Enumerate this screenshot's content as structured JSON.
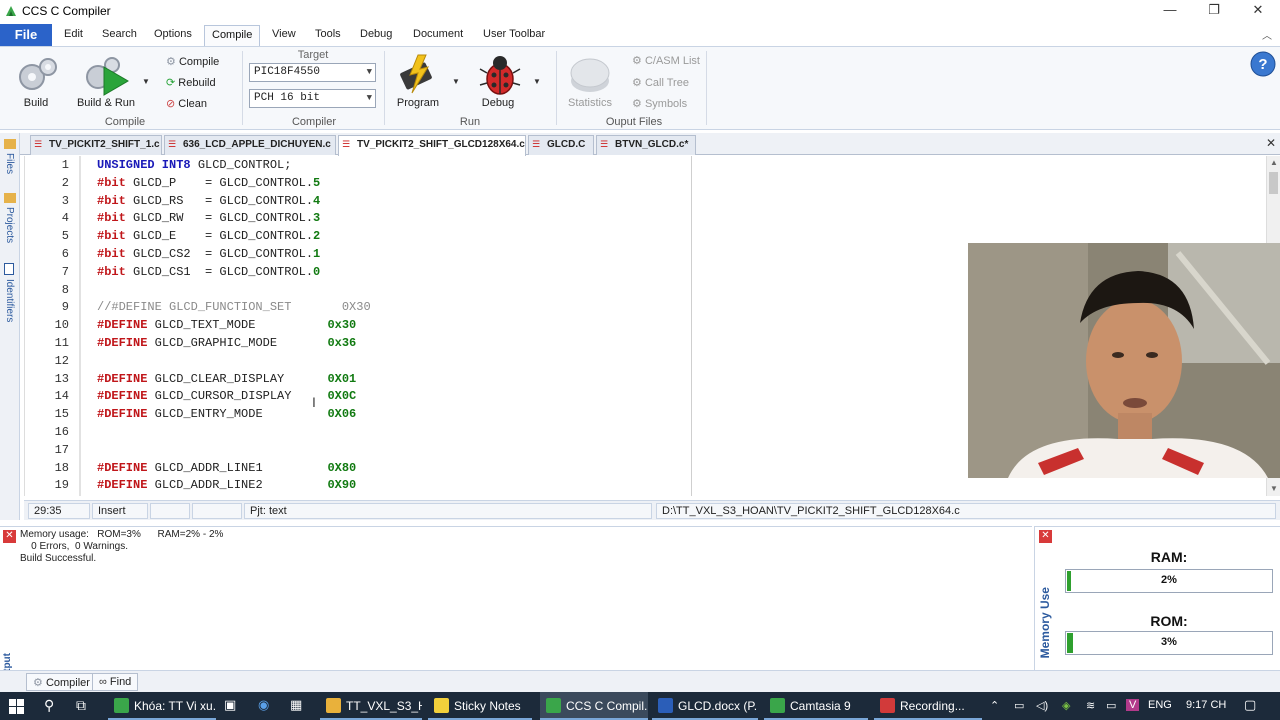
{
  "window": {
    "title": "CCS C Compiler",
    "minimize": "—",
    "maximize": "❐",
    "close": "✕"
  },
  "menu": {
    "file": "File",
    "tabs": [
      "Edit",
      "Search",
      "Options",
      "Compile",
      "View",
      "Tools",
      "Debug",
      "Document",
      "User Toolbar"
    ],
    "active": "Compile"
  },
  "ribbon": {
    "build": "Build",
    "build_run": "Build & Run",
    "compile": "Compile",
    "rebuild": "Rebuild",
    "clean": "Clean",
    "group_compile": "Compile",
    "target_label": "Target",
    "target_device": "PIC18F4550",
    "target_compiler": "PCH 16 bit",
    "group_compiler": "Compiler",
    "program": "Program",
    "debug": "Debug",
    "group_run": "Run",
    "statistics": "Statistics",
    "casm_list": "C/ASM List",
    "call_tree": "Call Tree",
    "symbols": "Symbols",
    "group_output": "Ouput Files"
  },
  "doc_tabs": [
    {
      "label": "TV_PICKIT2_SHIFT_1.c"
    },
    {
      "label": "636_LCD_APPLE_DICHUYEN.c"
    },
    {
      "label": "TV_PICKIT2_SHIFT_GLCD128X64.c"
    },
    {
      "label": "GLCD.C"
    },
    {
      "label": "BTVN_GLCD.c*"
    }
  ],
  "side_tabs": {
    "files": "Files",
    "projects": "Projects",
    "identifiers": "Identifiers"
  },
  "editor": {
    "line_numbers": [
      "1",
      "2",
      "3",
      "4",
      "5",
      "6",
      "7",
      "8",
      "9",
      "10",
      "11",
      "12",
      "13",
      "14",
      "15",
      "16",
      "17",
      "18",
      "19"
    ],
    "lines": [
      {
        "a": "UNSIGNED INT8",
        "b": " GLCD_CONTROL;",
        "c": ""
      },
      {
        "a": "#bit",
        "b": " GLCD_P    = GLCD_CONTROL.",
        "c": "5"
      },
      {
        "a": "#bit",
        "b": " GLCD_RS   = GLCD_CONTROL.",
        "c": "4"
      },
      {
        "a": "#bit",
        "b": " GLCD_RW   = GLCD_CONTROL.",
        "c": "3"
      },
      {
        "a": "#bit",
        "b": " GLCD_E    = GLCD_CONTROL.",
        "c": "2"
      },
      {
        "a": "#bit",
        "b": " GLCD_CS2  = GLCD_CONTROL.",
        "c": "1"
      },
      {
        "a": "#bit",
        "b": " GLCD_CS1  = GLCD_CONTROL.",
        "c": "0"
      },
      {
        "a": "",
        "b": "",
        "c": ""
      },
      {
        "a": "",
        "b": "//#DEFINE GLCD_FUNCTION_SET       0X30",
        "c": ""
      },
      {
        "a": "#DEFINE",
        "b": " GLCD_TEXT_MODE          ",
        "c": "0x30"
      },
      {
        "a": "#DEFINE",
        "b": " GLCD_GRAPHIC_MODE       ",
        "c": "0x36"
      },
      {
        "a": "",
        "b": "",
        "c": ""
      },
      {
        "a": "#DEFINE",
        "b": " GLCD_CLEAR_DISPLAY      ",
        "c": "0X01"
      },
      {
        "a": "#DEFINE",
        "b": " GLCD_CURSOR_DISPLAY     ",
        "c": "0X0C"
      },
      {
        "a": "#DEFINE",
        "b": " GLCD_ENTRY_MODE         ",
        "c": "0X06"
      },
      {
        "a": "",
        "b": "",
        "c": ""
      },
      {
        "a": "",
        "b": "",
        "c": ""
      },
      {
        "a": "#DEFINE",
        "b": " GLCD_ADDR_LINE1         ",
        "c": "0X80"
      },
      {
        "a": "#DEFINE",
        "b": " GLCD_ADDR_LINE2         ",
        "c": "0X90"
      }
    ]
  },
  "status": {
    "position": "29:35",
    "mode": "Insert",
    "pjt": "Pjt: text",
    "path": "D:\\TT_VXL_S3_HOAN\\TV_PICKIT2_SHIFT_GLCD128X64.c"
  },
  "output": {
    "vertical_label": "Output",
    "lines": [
      "Memory usage:   ROM=3%      RAM=2% - 2%",
      "    0 Errors,  0 Warnings.",
      "Build Successful."
    ]
  },
  "memory": {
    "vertical_label": "Memory Use",
    "ram_label": "RAM:",
    "ram_value": "2%",
    "ram_fraction": 0.02,
    "rom_label": "ROM:",
    "rom_value": "3%",
    "rom_fraction": 0.03
  },
  "bottom_tabs": {
    "compiler": "Compiler",
    "find": "Find"
  },
  "taskbar": {
    "items": [
      {
        "label": "Khóa: TT Vi xu...",
        "color": "#3aa64a"
      },
      {
        "label": "TT_VXL_S3_H...",
        "color": "#e9b13b"
      },
      {
        "label": "Sticky Notes",
        "color": "#f2d03b"
      },
      {
        "label": "CCS C Compil...",
        "color": "#3aa64a"
      },
      {
        "label": "GLCD.docx (P...",
        "color": "#2b5eb8"
      },
      {
        "label": "Camtasia 9",
        "color": "#3aa64a"
      },
      {
        "label": "Recording...",
        "color": "#d23a3a"
      }
    ],
    "lang": "ENG",
    "time": "9:17 CH"
  },
  "colors": {
    "accent": "#2b63c9",
    "keyword": "#1a1ab8",
    "preprocessor": "#c0161a",
    "number": "#117a11",
    "taskbar": "#1c2a3a"
  }
}
